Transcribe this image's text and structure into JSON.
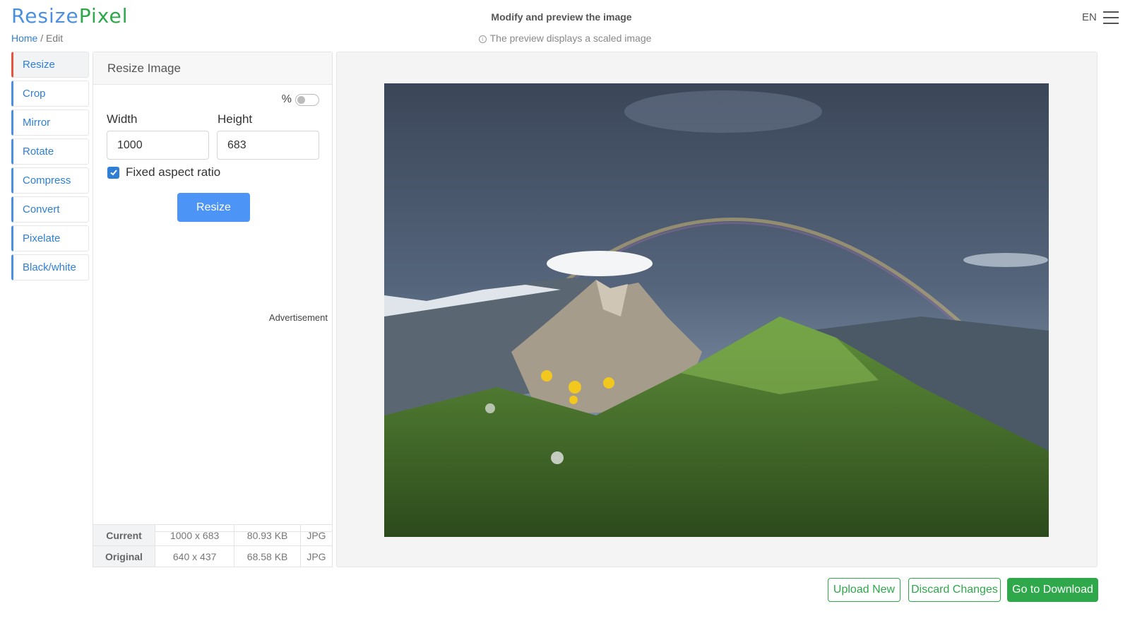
{
  "brand": {
    "part1": "Resize",
    "part2": "Pixel"
  },
  "breadcrumb": {
    "home": "Home",
    "separator": "/",
    "current": "Edit"
  },
  "header": {
    "title": "Modify and preview the image",
    "note": "The preview displays a scaled image",
    "language": "EN"
  },
  "sidebar": {
    "items": [
      {
        "label": "Resize",
        "active": true
      },
      {
        "label": "Crop"
      },
      {
        "label": "Mirror"
      },
      {
        "label": "Rotate"
      },
      {
        "label": "Compress"
      },
      {
        "label": "Convert"
      },
      {
        "label": "Pixelate"
      },
      {
        "label": "Black/white"
      }
    ]
  },
  "panel": {
    "title": "Resize Image",
    "percent_label": "%",
    "percent_toggle_on": false,
    "width_label": "Width",
    "width_value": "1000",
    "height_label": "Height",
    "height_value": "683",
    "aspect_label": "Fixed aspect ratio",
    "aspect_checked": true,
    "resize_button": "Resize",
    "ad_label": "Advertisement"
  },
  "info_table": {
    "rows": [
      {
        "label": "Current",
        "dimensions": "1000 x 683",
        "size": "80.93 KB",
        "format": "JPG"
      },
      {
        "label": "Original",
        "dimensions": "640 x 437",
        "size": "68.58 KB",
        "format": "JPG"
      }
    ]
  },
  "actions": {
    "upload": "Upload New",
    "discard": "Discard Changes",
    "download": "Go to Download"
  },
  "colors": {
    "accent_blue": "#4a90e2",
    "accent_green": "#2ea84a",
    "active_marker": "#e8553e",
    "button_blue": "#4d94f7"
  }
}
